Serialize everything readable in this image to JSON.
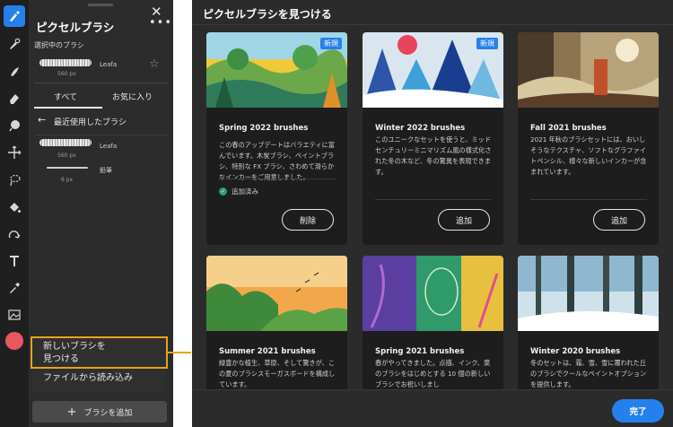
{
  "toolbar": {
    "tools": [
      "pixel-brush-icon",
      "paint-brush-icon",
      "smudge-icon",
      "eraser-icon",
      "blob-icon",
      "move-icon",
      "lasso-icon",
      "fill-icon",
      "transform-icon",
      "text-icon",
      "eyedropper-icon",
      "image-icon"
    ],
    "active_color": "#e8575f",
    "accent": "#2680eb"
  },
  "panel": {
    "title": "ピクセルブラシ",
    "selected_label": "選択中のブラシ",
    "selected_brush": {
      "name": "Leafa",
      "size": "560 px"
    },
    "tabs": [
      "すべて",
      "お気に入り"
    ],
    "recent_label": "最近使用したブラシ",
    "recent": [
      {
        "name": "Leafa",
        "size": "560 px"
      },
      {
        "name": "鉛筆",
        "size": "6 px"
      }
    ],
    "menu": {
      "find_line1": "新しいブラシを",
      "find_line2": "見つける",
      "import": "ファイルから読み込み"
    },
    "add_button": "ブラシを追加"
  },
  "dialog": {
    "title": "ピクセルブラシを見つける",
    "done": "完了",
    "cards": [
      {
        "title": "Spring 2022 brushes",
        "badge": "新規",
        "desc": "この春のアップデートはバラエティに富んでいます。木炭ブラシ、ペイントブラシ、特別な FX ブラシ、さわめて滑らかなインカーをご用意しました。",
        "status": "追加済み",
        "action": "削除"
      },
      {
        "title": "Winter 2022 brushes",
        "badge": "新規",
        "desc": "このユニークなセットを使うと、ミッドセンチュリーミニマリズム風の様式化された冬の木など、冬の驚異を表現できます。",
        "action": "追加"
      },
      {
        "title": "Fall 2021 brushes",
        "desc": "2021 年秋のブラシセットには、おいしそうなテクスチャ、ソフトなグラファイトペンシル、様々な新しいインカーが含まれています。",
        "action": "追加"
      },
      {
        "title": "Summer 2021 brushes",
        "desc": "緑豊かな植生、草原、そして驚きが、この夏のブラシスモーガスボードを構成しています。"
      },
      {
        "title": "Spring 2021 brushes",
        "desc": "春がやってきました。点描、インク、葉のブラシをはじめとする 10 個の新しいブラシでお祝いしまし"
      },
      {
        "title": "Winter 2020 brushes",
        "desc": "冬のセットは、霜、雪、雪に覆われた丘のブラシでクールなペイントオプションを提供します。"
      }
    ]
  }
}
